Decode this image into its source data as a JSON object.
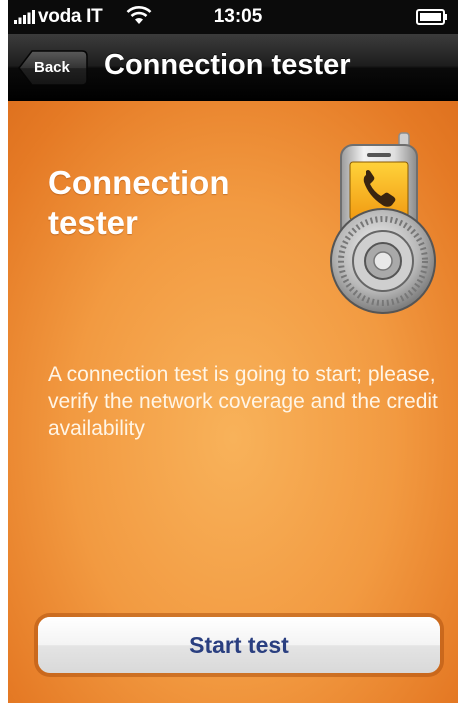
{
  "status_bar": {
    "carrier": "voda IT",
    "time": "13:05",
    "signal_icon": "signal-bars-icon",
    "wifi_icon": "wifi-icon",
    "battery_icon": "battery-icon"
  },
  "nav_bar": {
    "back_label": "Back",
    "title": "Connection tester"
  },
  "main": {
    "heading": "Connection tester",
    "icon": "phone-lock-icon",
    "message": "A connection test is going to start; please, verify the network coverage and the credit availability",
    "start_button_label": "Start test"
  },
  "colors": {
    "background_orange": "#f29a41",
    "nav_bar_black": "#000000",
    "button_text_blue": "#2a3f80"
  }
}
